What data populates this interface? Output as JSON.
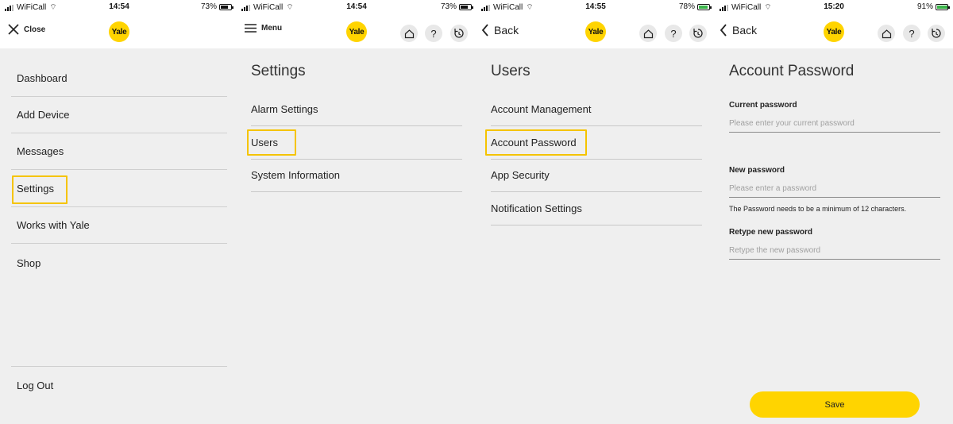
{
  "panel1": {
    "status": {
      "carrier": "WiFiCall",
      "time": "14:54",
      "battery": "73%"
    },
    "nav": {
      "close_label": "Close",
      "logo": "Yale"
    },
    "menu": [
      {
        "label": "Dashboard"
      },
      {
        "label": "Add Device"
      },
      {
        "label": "Messages"
      },
      {
        "label": "Settings"
      },
      {
        "label": "Works with Yale"
      },
      {
        "label": "Shop"
      }
    ],
    "logout_label": "Log Out"
  },
  "panel2": {
    "status": {
      "carrier": "WiFiCall",
      "time": "14:54",
      "battery": "73%"
    },
    "nav": {
      "menu_label": "Menu",
      "logo": "Yale",
      "home_icon": "home-icon",
      "help_icon": "?",
      "history_icon": "history-icon"
    },
    "title": "Settings",
    "items": [
      {
        "label": "Alarm Settings"
      },
      {
        "label": "Users"
      },
      {
        "label": "System Information"
      }
    ]
  },
  "panel3": {
    "status": {
      "carrier": "WiFiCall",
      "time": "14:55",
      "battery": "78%"
    },
    "nav": {
      "back_label": "Back",
      "logo": "Yale"
    },
    "title": "Users",
    "items": [
      {
        "label": "Account Management"
      },
      {
        "label": "Account Password"
      },
      {
        "label": "App Security"
      },
      {
        "label": "Notification Settings"
      }
    ]
  },
  "panel4": {
    "status": {
      "carrier": "WiFiCall",
      "time": "15:20",
      "battery": "91%"
    },
    "nav": {
      "back_label": "Back",
      "logo": "Yale"
    },
    "title": "Account Password",
    "current": {
      "label": "Current password",
      "placeholder": "Please enter your current password"
    },
    "new": {
      "label": "New password",
      "placeholder": "Please enter a password",
      "hint": "The Password needs to be a minimum of 12 characters."
    },
    "retype": {
      "label": "Retype new password",
      "placeholder": "Retype the new password"
    },
    "save_label": "Save"
  },
  "colors": {
    "accent": "#ffd400",
    "highlight": "#f5c400",
    "background": "#efefef"
  }
}
